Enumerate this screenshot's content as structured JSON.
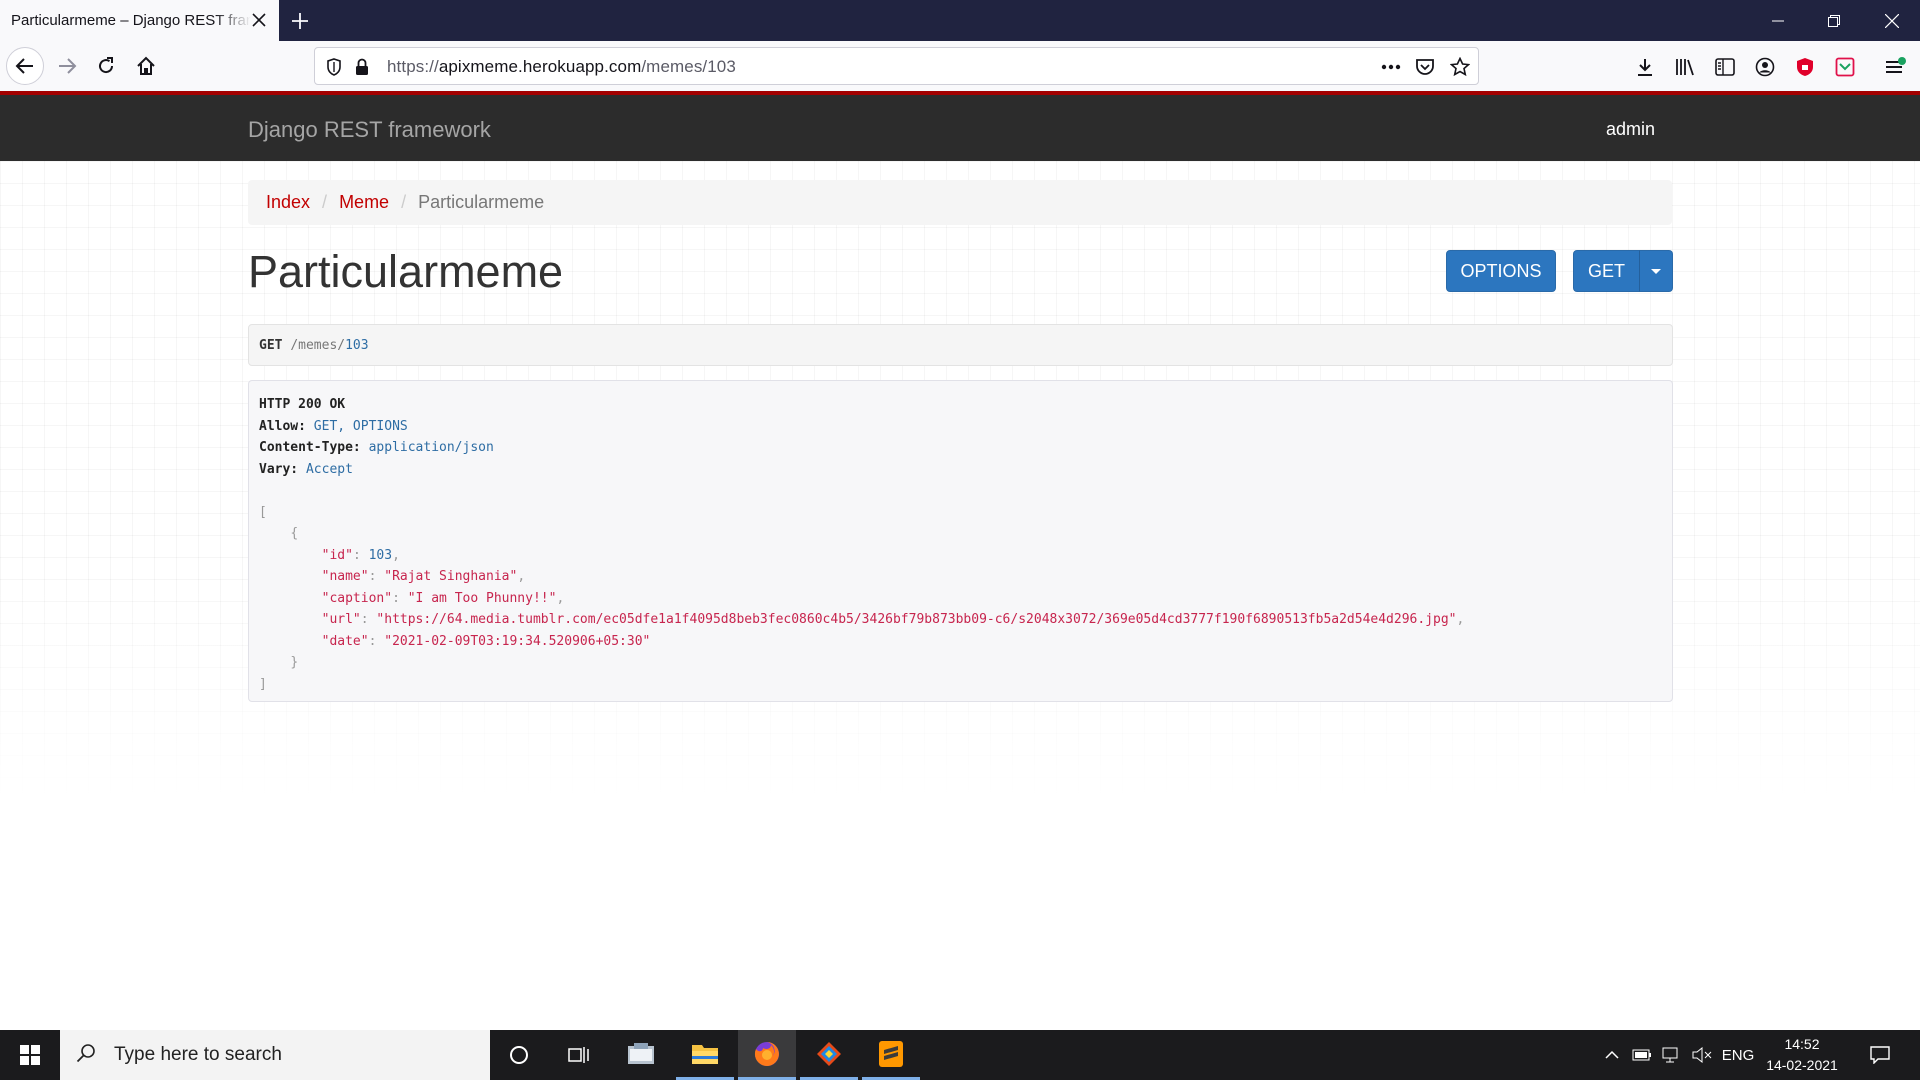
{
  "browser": {
    "tab_title": "Particularmeme – Django REST framework",
    "url_scheme": "https://",
    "url_host": "apixmeme.herokuapp.com",
    "url_path": "/memes/103",
    "accent_color": "#a30000"
  },
  "drf": {
    "brand": "Django REST framework",
    "user": "admin",
    "breadcrumb": {
      "items": [
        "Index",
        "Meme"
      ],
      "active": "Particularmeme"
    },
    "title": "Particularmeme",
    "buttons": {
      "options": "OPTIONS",
      "get": "GET"
    },
    "request": {
      "method": "GET",
      "path_prefix": "/memes/",
      "path_id": "103"
    },
    "response": {
      "status": "HTTP 200 OK",
      "headers": [
        {
          "name": "Allow:",
          "value": "GET, OPTIONS"
        },
        {
          "name": "Content-Type:",
          "value": "application/json"
        },
        {
          "name": "Vary:",
          "value": "Accept"
        }
      ],
      "body": {
        "id": "103",
        "name": "\"Rajat Singhania\"",
        "caption": "\"I am Too Phunny!!\"",
        "url": "\"https://64.media.tumblr.com/ec05dfe1a1f4095d8beb3fec0860c4b5/3426bf79b873bb09-c6/s2048x3072/369e05d4cd3777f190f6890513fb5a2d54e4d296.jpg\"",
        "date": "\"2021-02-09T03:19:34.520906+05:30\""
      }
    }
  },
  "taskbar": {
    "search_placeholder": "Type here to search",
    "language": "ENG",
    "time": "14:52",
    "date": "14-02-2021"
  }
}
